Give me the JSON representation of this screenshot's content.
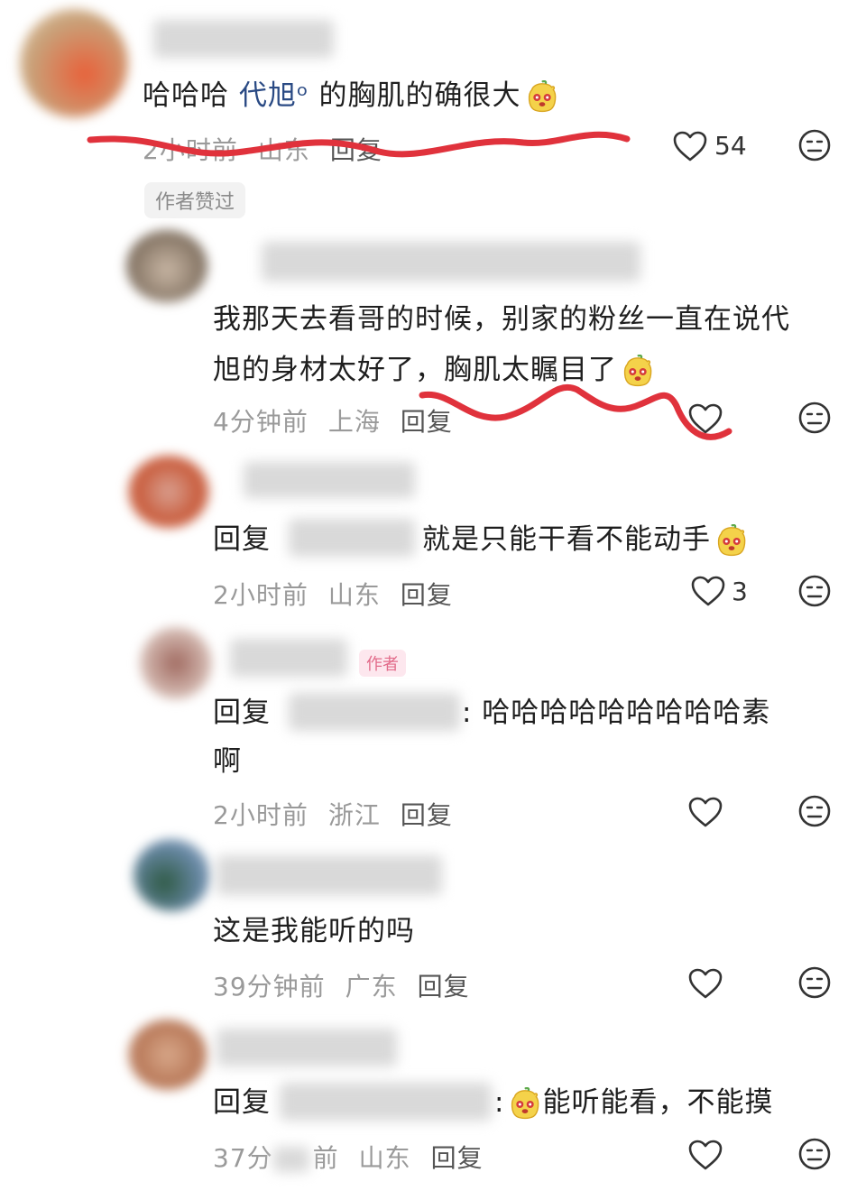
{
  "comments": [
    {
      "segments": [
        "哈哈哈 ",
        "代旭ᵒ",
        " 的胸肌的确很大"
      ],
      "time": "2小时前",
      "location": "山东",
      "reply_label": "回复",
      "likes": "54",
      "tag": "作者赞过"
    },
    {
      "line1": "我那天去看哥的时候，别家的粉丝一直在说代",
      "line2": "旭的身材太好了，胸肌太瞩目了",
      "time": "4分钟前",
      "location": "上海",
      "reply_label": "回复",
      "likes": ""
    },
    {
      "prefix": "回复",
      "text": "就是只能干看不能动手",
      "time": "2小时前",
      "location": "山东",
      "reply_label": "回复",
      "likes": "3"
    },
    {
      "prefix": "回复",
      "text": ": 哈哈哈哈哈哈哈哈哈素",
      "line2": "啊",
      "author_badge": "作者",
      "time": "2小时前",
      "location": "浙江",
      "reply_label": "回复",
      "likes": ""
    },
    {
      "text": "这是我能听的吗",
      "time": "39分钟前",
      "location": "广东",
      "reply_label": "回复",
      "likes": ""
    },
    {
      "prefix": "回复",
      "text": "能听能看，不能摸",
      "colon": ":",
      "time": "37分",
      "time_rest": "前",
      "location": "山东",
      "reply_label": "回复",
      "likes": ""
    }
  ],
  "icons": {
    "like": "heart-outline-icon",
    "dislike": "neutral-face-icon",
    "emoji": "mango-face-emoji"
  },
  "colors": {
    "text": "#1f1f1f",
    "meta": "#9a9a9a",
    "mention": "#2a4a84",
    "annotation": "#e0323c"
  }
}
